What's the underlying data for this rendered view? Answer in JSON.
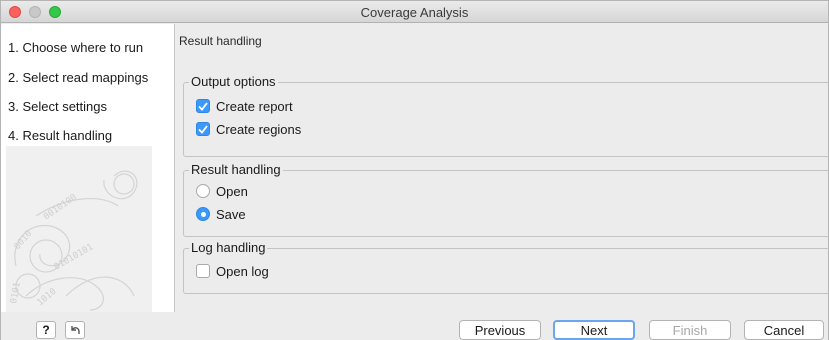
{
  "window": {
    "title": "Coverage Analysis"
  },
  "sidebar": {
    "steps": [
      {
        "label": "1.  Choose where to run"
      },
      {
        "label": "2.  Select read mappings"
      },
      {
        "label": "3.  Select settings"
      },
      {
        "label": "4.  Result handling"
      }
    ]
  },
  "main": {
    "title": "Result handling",
    "output_options": {
      "legend": "Output options",
      "create_report": {
        "label": "Create report",
        "checked": true
      },
      "create_regions": {
        "label": "Create regions",
        "checked": true
      }
    },
    "result_handling": {
      "legend": "Result handling",
      "open": {
        "label": "Open",
        "selected": false
      },
      "save": {
        "label": "Save",
        "selected": true
      }
    },
    "log_handling": {
      "legend": "Log handling",
      "open_log": {
        "label": "Open log",
        "checked": false
      }
    }
  },
  "footer": {
    "help_label": "?",
    "reset_icon": "reset-arrow-icon",
    "previous_label": "Previous",
    "next_label": "Next",
    "finish_label": "Finish",
    "cancel_label": "Cancel"
  },
  "colors": {
    "accent": "#3b99fc",
    "default_button_border": "#68a7ee"
  }
}
